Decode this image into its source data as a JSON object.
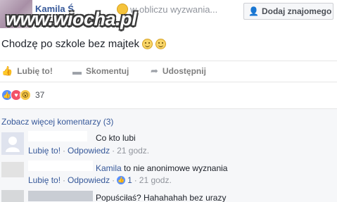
{
  "post": {
    "author": "Kamila Ś",
    "author_sub": "...",
    "status_text": "w obliczu wyzwania...",
    "add_friend_label": "Dodaj znajomego",
    "body": "Chodzę po szkole bez majtek",
    "watermark": "www.wiocha.pl"
  },
  "actions": {
    "like": "Lubię to!",
    "comment": "Skomentuj",
    "share": "Udostępnij"
  },
  "reactions": {
    "count": "37"
  },
  "comments": {
    "more_link": "Zobacz więcej komentarzy (3)",
    "items": [
      {
        "text": "Co kto lubi",
        "like": "Lubię to!",
        "reply": "Odpowiedz",
        "time": "21 godz."
      },
      {
        "name": "Kamila",
        "text": "to nie anonimowe wyznania",
        "like": "Lubię to!",
        "reply": "Odpowiedz",
        "likes": "1",
        "time": "21 godz."
      },
      {
        "text": "Popuściłaś? Hahahahah bez urazy"
      }
    ]
  },
  "colors": {
    "link": "#365899",
    "muted": "#90949c",
    "like_blue": "#5890ff",
    "love_red": "#f25268"
  }
}
